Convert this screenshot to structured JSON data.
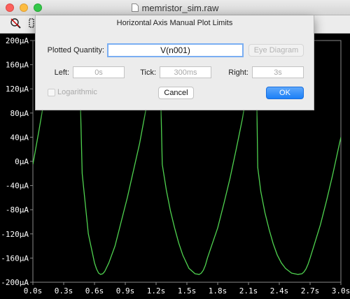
{
  "window": {
    "title": "memristor_sim.raw",
    "icon": "raw-file-icon"
  },
  "toolbar": {
    "icons": [
      "zoom-reset-icon",
      "zoom-area-icon"
    ]
  },
  "dialog": {
    "title": "Horizontal Axis Manual Plot Limits",
    "plotted_quantity_label": "Plotted Quantity:",
    "plotted_quantity_value": "V(n001)",
    "eye_diagram_label": "Eye Diagram",
    "left_label": "Left:",
    "left_value": "0s",
    "tick_label": "Tick:",
    "tick_value": "300ms",
    "right_label": "Right:",
    "right_value": "3s",
    "logarithmic_label": "Logarithmic",
    "logarithmic_checked": false,
    "cancel_label": "Cancel",
    "ok_label": "OK"
  },
  "colors": {
    "plot_background": "#000000",
    "trace": "#4fd24f",
    "grid_text": "#ffffff",
    "accent": "#1b7ff7"
  },
  "chart_data": {
    "type": "line",
    "xlim": [
      0,
      3.0
    ],
    "ylim": [
      -200,
      200
    ],
    "x_ticks": [
      "0.0s",
      "0.3s",
      "0.6s",
      "0.9s",
      "1.2s",
      "1.5s",
      "1.8s",
      "2.1s",
      "2.4s",
      "2.7s",
      "3.0s"
    ],
    "y_ticks": [
      "200µA",
      "160µA",
      "120µA",
      "80µA",
      "40µA",
      "0µA",
      "-40µA",
      "-80µA",
      "-120µA",
      "-160µA",
      "-200µA"
    ],
    "series": [
      {
        "x": [
          0.0,
          0.06,
          0.12,
          0.18,
          0.24,
          0.3,
          0.36,
          0.42,
          0.48,
          0.54,
          0.6,
          0.62,
          0.64,
          0.66,
          0.68,
          0.7,
          0.74,
          0.8,
          0.86,
          0.92,
          0.98,
          1.04,
          1.1,
          1.14,
          1.16,
          1.17,
          1.19,
          1.22,
          1.26,
          1.3,
          1.34,
          1.38,
          1.42,
          1.46,
          1.52,
          1.58,
          1.62,
          1.64,
          1.66,
          1.68,
          1.7,
          1.74,
          1.8,
          1.86,
          1.92,
          1.98,
          2.04,
          2.1,
          2.14,
          2.16,
          2.17,
          2.19,
          2.22,
          2.26,
          2.3,
          2.34,
          2.38,
          2.42,
          2.46,
          2.52,
          2.58,
          2.62,
          2.64,
          2.66,
          2.68,
          2.7,
          2.74,
          2.8,
          2.86,
          2.92,
          2.98,
          3.0
        ],
        "y": [
          -5,
          52,
          112,
          170,
          230,
          290,
          340,
          390,
          -20,
          -120,
          -168,
          -178,
          -185,
          -187,
          -186,
          -182,
          -168,
          -140,
          -100,
          -60,
          -15,
          30,
          85,
          135,
          170,
          200,
          230,
          300,
          -5,
          -48,
          -82,
          -110,
          -135,
          -155,
          -177,
          -186,
          -187,
          -185,
          -180,
          -172,
          -160,
          -140,
          -110,
          -70,
          -28,
          20,
          70,
          130,
          170,
          200,
          230,
          -10,
          -50,
          -85,
          -112,
          -136,
          -155,
          -168,
          -177,
          -185,
          -187,
          -186,
          -183,
          -178,
          -170,
          -160,
          -138,
          -105,
          -65,
          -22,
          25,
          40
        ]
      }
    ]
  }
}
